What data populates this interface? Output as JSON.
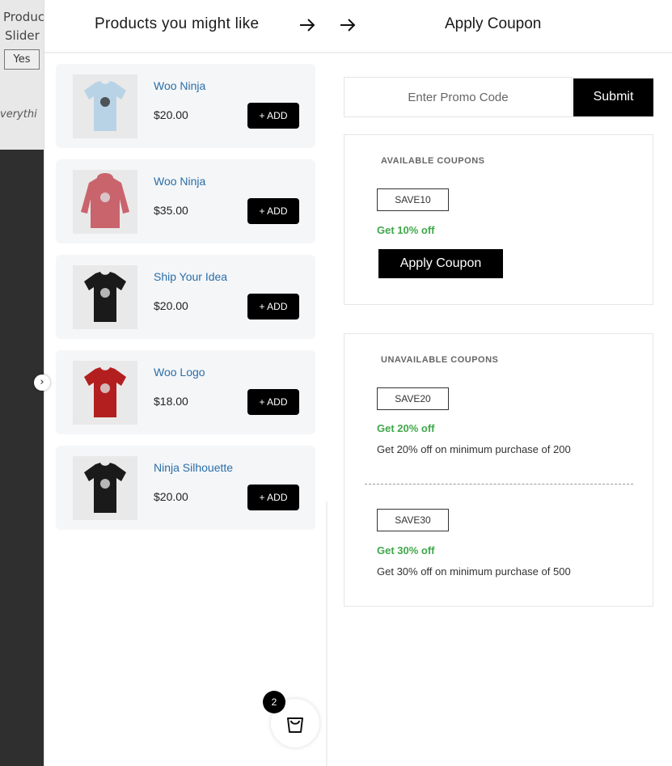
{
  "background": {
    "line1": "Produc",
    "line2": "Slider",
    "yes_label": "Yes",
    "italic_text": "verythi"
  },
  "header": {
    "products_title": "Products you might like",
    "coupon_title": "Apply Coupon"
  },
  "products": [
    {
      "name": "Woo Ninja",
      "price": "$20.00",
      "add_label": "+ ADD",
      "color": "#b9d3e6",
      "kind": "tee"
    },
    {
      "name": "Woo Ninja",
      "price": "$35.00",
      "add_label": "+ ADD",
      "color": "#c9646d",
      "kind": "hoodie"
    },
    {
      "name": "Ship Your Idea",
      "price": "$20.00",
      "add_label": "+ ADD",
      "color": "#1a1a1a",
      "kind": "tee"
    },
    {
      "name": "Woo Logo",
      "price": "$18.00",
      "add_label": "+ ADD",
      "color": "#b31f1f",
      "kind": "tee"
    },
    {
      "name": "Ninja Silhouette",
      "price": "$20.00",
      "add_label": "+ ADD",
      "color": "#1a1a1a",
      "kind": "tee"
    }
  ],
  "promo": {
    "placeholder": "Enter Promo Code",
    "submit_label": "Submit"
  },
  "available": {
    "title": "AVAILABLE COUPONS",
    "coupons": [
      {
        "code": "SAVE10",
        "off": "Get 10% off"
      }
    ],
    "apply_label": "Apply Coupon"
  },
  "unavailable": {
    "title": "UNAVAILABLE COUPONS",
    "coupons": [
      {
        "code": "SAVE20",
        "off": "Get 20% off",
        "desc": "Get 20% off on minimum purchase of 200"
      },
      {
        "code": "SAVE30",
        "off": "Get 30% off",
        "desc": "Get 30% off on minimum purchase of 500"
      }
    ]
  },
  "cart": {
    "count": "2"
  },
  "colors": {
    "accent_green": "#3fa84a",
    "link_blue": "#2b6ea8",
    "button_black": "#000000"
  }
}
